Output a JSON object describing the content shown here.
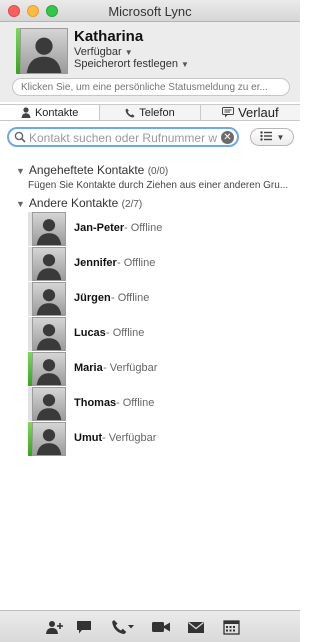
{
  "window": {
    "title": "Microsoft Lync"
  },
  "me": {
    "name": "Katharina",
    "status": "Verfügbar",
    "location": "Speicherort festlegen",
    "note_placeholder": "Klicken Sie, um eine persönliche Statusmeldung zu er..."
  },
  "tabs": [
    {
      "label": "Kontakte",
      "icon": "person-icon"
    },
    {
      "label": "Telefon",
      "icon": "phone-icon"
    },
    {
      "label": "Verlauf",
      "icon": "chat-history-icon"
    }
  ],
  "search": {
    "placeholder": "Kontakt suchen oder Rufnummer w"
  },
  "groups": [
    {
      "label": "Angeheftete Kontakte",
      "count": "(0/0)",
      "hint": "Fügen Sie Kontakte durch Ziehen aus einer anderen Gru..."
    },
    {
      "label": "Andere Kontakte",
      "count": "(2/7)"
    }
  ],
  "contacts": [
    {
      "name": "Jan-Peter",
      "status": "Offline"
    },
    {
      "name": "Jennifer",
      "status": "Offline"
    },
    {
      "name": "Jürgen",
      "status": "Offline"
    },
    {
      "name": "Lucas",
      "status": "Offline"
    },
    {
      "name": "Maria",
      "status": "Verfügbar"
    },
    {
      "name": "Thomas",
      "status": "Offline"
    },
    {
      "name": "Umut",
      "status": "Verfügbar"
    }
  ],
  "colors": {
    "available": "#36a31c",
    "search_focus": "#6fa8e6",
    "close": "#fc605c",
    "minimize": "#fdbc40",
    "maximize": "#34c84a"
  },
  "bottom_icons": [
    "add-contact-icon",
    "chat-icon",
    "call-icon",
    "video-icon",
    "mail-icon",
    "calendar-icon"
  ]
}
